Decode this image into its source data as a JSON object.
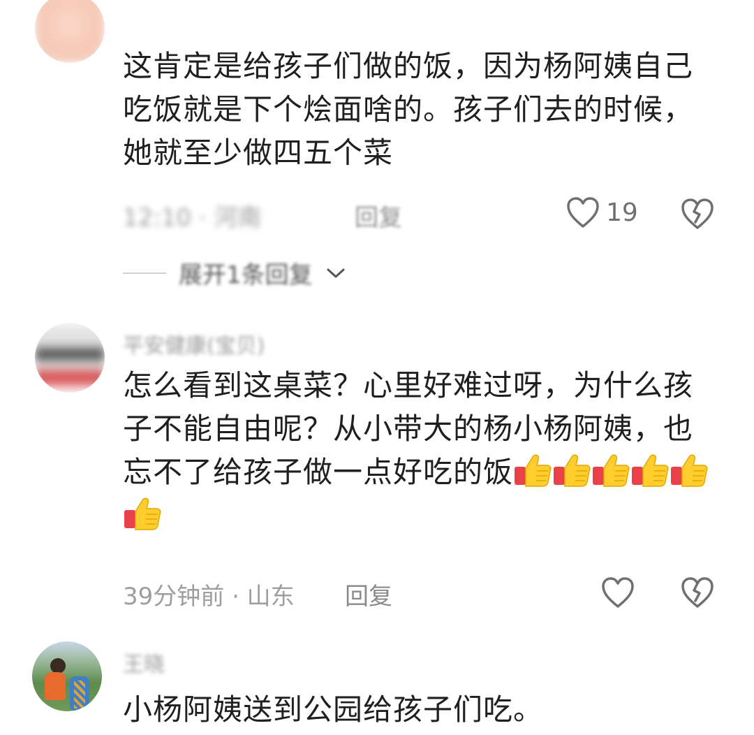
{
  "comments": [
    {
      "username": "",
      "text_lines": [
        "这肯定是给孩子们做的饭，因为杨阿姨自己",
        "吃饭就是下个烩面啥的。孩子们去的时候，",
        "她就至少做四五个菜"
      ],
      "meta": "12:10 · 河南",
      "reply_label": "回复",
      "like_count": "19",
      "expand_replies_label": "展开1条回复"
    },
    {
      "username": "平安健康(宝贝)",
      "text_lines": [
        "怎么看到这桌菜？心里好难过呀，为什么孩",
        "子不能自由呢？从小带大的杨小杨阿姨，也",
        "忘不了给孩子做一点好吃的饭"
      ],
      "emoji_count": 6,
      "meta": "39分钟前 · 山东",
      "reply_label": "回复"
    },
    {
      "username": "王晓",
      "text_lines": [
        "小杨阿姨送到公园给孩子们吃。"
      ]
    }
  ],
  "icons": {
    "like": "heart-outline-icon",
    "dislike": "broken-heart-icon",
    "expand": "chevron-down-icon",
    "emoji": "thumbs-up-emoji"
  },
  "colors": {
    "text": "#1f1f1f",
    "meta": "#9e9e9e",
    "icon": "#6f6f6f"
  }
}
